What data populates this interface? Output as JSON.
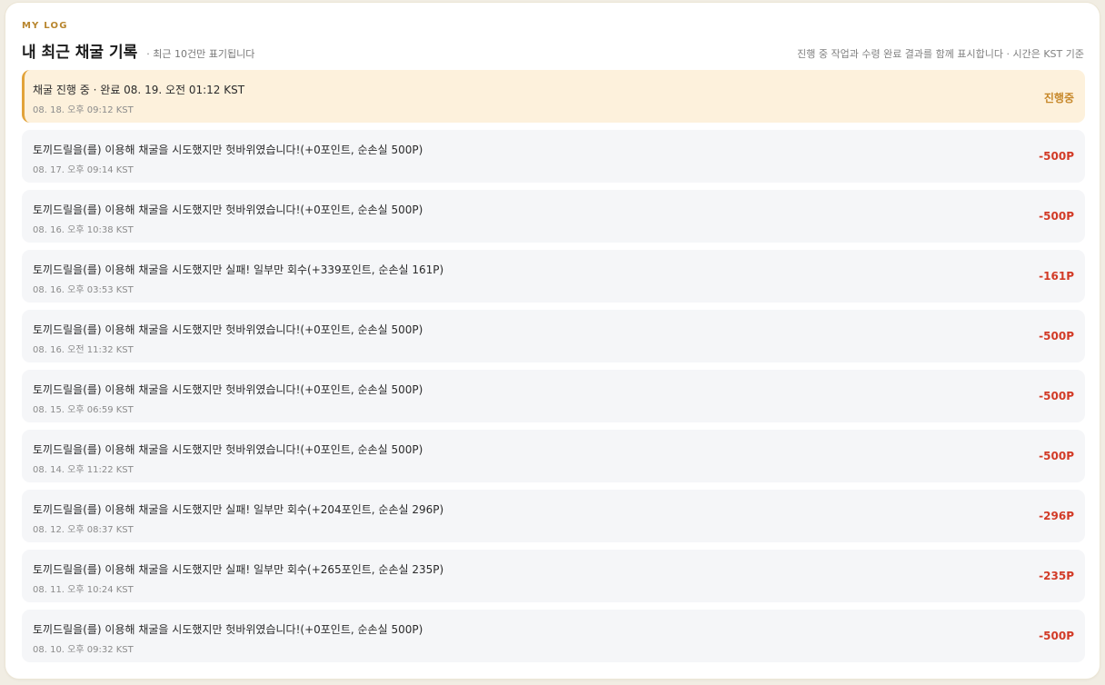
{
  "header": {
    "eyebrow": "MY LOG",
    "title": "내 최근 채굴 기록",
    "subtitle": "· 최근 10건만 표기됩니다",
    "note": "진행 중 작업과 수령 완료 결과를 함께 표시합니다 · 시간은 KST 기준"
  },
  "colors": {
    "accent": "#e2a33a",
    "loss": "#d23b27",
    "pending": "#c7882a"
  },
  "items": [
    {
      "title": "채굴 진행 중 · 완료 08. 19. 오전 01:12 KST",
      "time": "08. 18. 오후 09:12 KST",
      "amount": "진행중",
      "status": "active"
    },
    {
      "title": "토끼드릴을(를) 이용해 채굴을 시도했지만 헛바위였습니다!(+0포인트, 순손실 500P)",
      "time": "08. 17. 오후 09:14 KST",
      "amount": "-500P",
      "status": "done"
    },
    {
      "title": "토끼드릴을(를) 이용해 채굴을 시도했지만 헛바위였습니다!(+0포인트, 순손실 500P)",
      "time": "08. 16. 오후 10:38 KST",
      "amount": "-500P",
      "status": "done"
    },
    {
      "title": "토끼드릴을(를) 이용해 채굴을 시도했지만 실패! 일부만 회수(+339포인트, 순손실 161P)",
      "time": "08. 16. 오후 03:53 KST",
      "amount": "-161P",
      "status": "done"
    },
    {
      "title": "토끼드릴을(를) 이용해 채굴을 시도했지만 헛바위였습니다!(+0포인트, 순손실 500P)",
      "time": "08. 16. 오전 11:32 KST",
      "amount": "-500P",
      "status": "done"
    },
    {
      "title": "토끼드릴을(를) 이용해 채굴을 시도했지만 헛바위였습니다!(+0포인트, 순손실 500P)",
      "time": "08. 15. 오후 06:59 KST",
      "amount": "-500P",
      "status": "done"
    },
    {
      "title": "토끼드릴을(를) 이용해 채굴을 시도했지만 헛바위였습니다!(+0포인트, 순손실 500P)",
      "time": "08. 14. 오후 11:22 KST",
      "amount": "-500P",
      "status": "done"
    },
    {
      "title": "토끼드릴을(를) 이용해 채굴을 시도했지만 실패! 일부만 회수(+204포인트, 순손실 296P)",
      "time": "08. 12. 오후 08:37 KST",
      "amount": "-296P",
      "status": "done"
    },
    {
      "title": "토끼드릴을(를) 이용해 채굴을 시도했지만 실패! 일부만 회수(+265포인트, 순손실 235P)",
      "time": "08. 11. 오후 10:24 KST",
      "amount": "-235P",
      "status": "done"
    },
    {
      "title": "토끼드릴을(를) 이용해 채굴을 시도했지만 헛바위였습니다!(+0포인트, 순손실 500P)",
      "time": "08. 10. 오후 09:32 KST",
      "amount": "-500P",
      "status": "done"
    }
  ]
}
